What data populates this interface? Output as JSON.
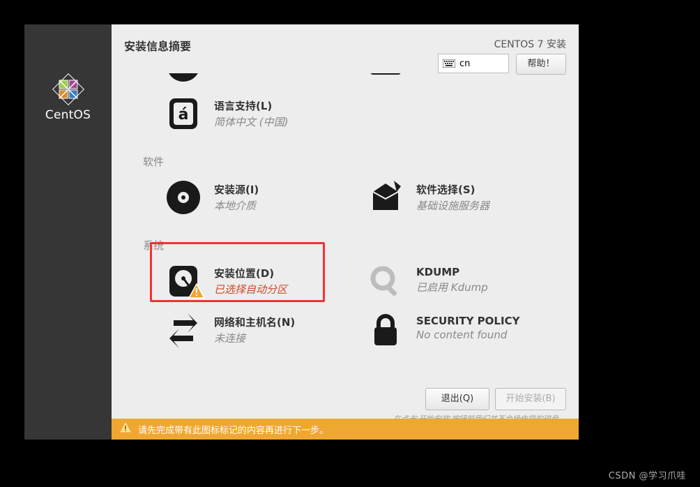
{
  "sidebar": {
    "brand": "CentOS"
  },
  "header": {
    "title": "安装信息摘要",
    "subtitle": "CENTOS 7 安装",
    "lang_value": "cn",
    "help_label": "帮助！"
  },
  "categories": {
    "software": "软件",
    "system": "系统"
  },
  "spokes": {
    "lang_support": {
      "title": "语言支持(L)",
      "status": "简体中文 (中国)"
    },
    "install_source": {
      "title": "安装源(I)",
      "status": "本地介质"
    },
    "software_sel": {
      "title": "软件选择(S)",
      "status": "基础设施服务器"
    },
    "install_dest": {
      "title": "安装位置(D)",
      "status": "已选择自动分区"
    },
    "kdump": {
      "title": "KDUMP",
      "status": "已启用 Kdump"
    },
    "network": {
      "title": "网络和主机名(N)",
      "status": "未连接"
    },
    "security": {
      "title": "SECURITY POLICY",
      "status": "No content found"
    }
  },
  "footer": {
    "quit": "退出(Q)",
    "begin": "开始安装(B)",
    "note": "在点击'开始安装'按钮前我们并不会操作您的磁盘。"
  },
  "warning_bar": "请先完成带有此图标标记的内容再进行下一步。",
  "watermark": "CSDN @学习爪哇"
}
